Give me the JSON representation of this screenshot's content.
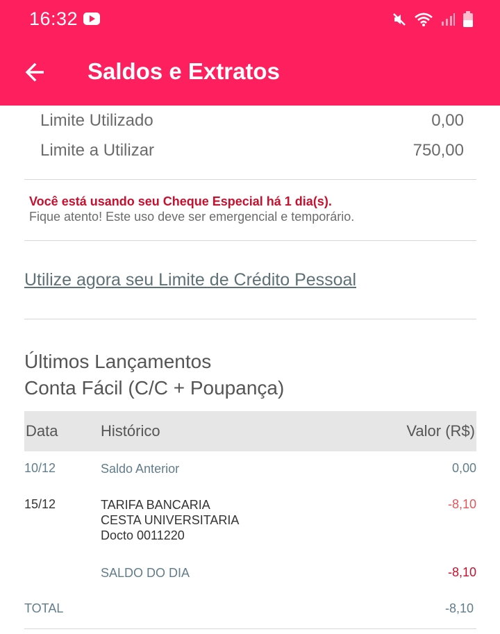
{
  "status_bar": {
    "time": "16:32",
    "icons": [
      "youtube-icon",
      "mute-icon",
      "wifi-icon",
      "signal-icon",
      "battery-icon"
    ]
  },
  "header": {
    "title": "Saldos e Extratos",
    "back_icon": "arrow-left-icon"
  },
  "limits": [
    {
      "label": "Limite Utilizado",
      "value": "0,00"
    },
    {
      "label": "Limite a Utilizar",
      "value": "750,00"
    }
  ],
  "alert": {
    "warning": "Você está usando seu Cheque Especial há 1 dia(s).",
    "advice": "Fique atento! Este uso deve ser emergencial e temporário."
  },
  "credit_link": "Utilize agora seu Limite de Crédito Pessoal",
  "statement": {
    "title_line1": "Últimos Lançamentos",
    "title_line2": "Conta Fácil (C/C + Poupança)",
    "columns": {
      "date": "Data",
      "history": "Histórico",
      "value": "Valor (R$)"
    },
    "rows": [
      {
        "date": "10/12",
        "history": [
          "Saldo Anterior"
        ],
        "value": "0,00"
      },
      {
        "date": "15/12",
        "history": [
          "TARIFA BANCARIA",
          "CESTA UNIVERSITARIA",
          "Docto 0011220"
        ],
        "value": "-8,10"
      },
      {
        "date": "",
        "history": [
          "SALDO DO DIA"
        ],
        "value": "-8,10"
      }
    ],
    "total_label": "TOTAL",
    "total_value": "-8,10"
  },
  "colors": {
    "brand": "#fe1f5f",
    "alert_red": "#c8102e",
    "link": "#5e7177",
    "muted_blue_grey": "#607d8b"
  }
}
